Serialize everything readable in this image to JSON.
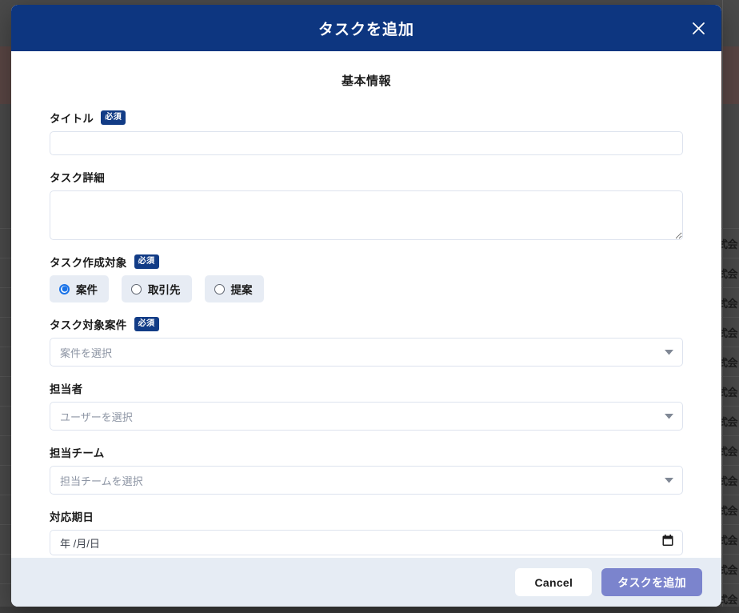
{
  "modal": {
    "title": "タスクを追加",
    "close_icon": "close-icon",
    "section_title": "基本情報",
    "required_badge": "必須",
    "fields": {
      "title": {
        "label": "タイトル",
        "required": true,
        "value": "",
        "placeholder": ""
      },
      "detail": {
        "label": "タスク詳細",
        "required": false,
        "value": "",
        "placeholder": ""
      },
      "target_type": {
        "label": "タスク作成対象",
        "required": true,
        "selected": "案件",
        "options": [
          "案件",
          "取引先",
          "提案"
        ]
      },
      "target_case": {
        "label": "タスク対象案件",
        "required": true,
        "value": "",
        "placeholder": "案件を選択"
      },
      "assignee": {
        "label": "担当者",
        "required": false,
        "value": "",
        "placeholder": "ユーザーを選択"
      },
      "team": {
        "label": "担当チーム",
        "required": false,
        "value": "",
        "placeholder": "担当チームを選択"
      },
      "due_date": {
        "label": "対応期日",
        "required": false,
        "value": "",
        "placeholder": "年 /月/日"
      }
    },
    "footer": {
      "cancel_label": "Cancel",
      "submit_label": "タスクを追加"
    }
  },
  "background": {
    "row_cell_text": "式会",
    "row_count": 13
  },
  "colors": {
    "header_navy": "#0d3680",
    "badge_navy": "#123c86",
    "radio_blue": "#1a73e8",
    "pill_bg": "#e7ecf4",
    "footer_bg": "#e6ecf4",
    "submit_bg": "#7b84cd",
    "input_border": "#dde3ee",
    "placeholder": "#8d95a4"
  }
}
